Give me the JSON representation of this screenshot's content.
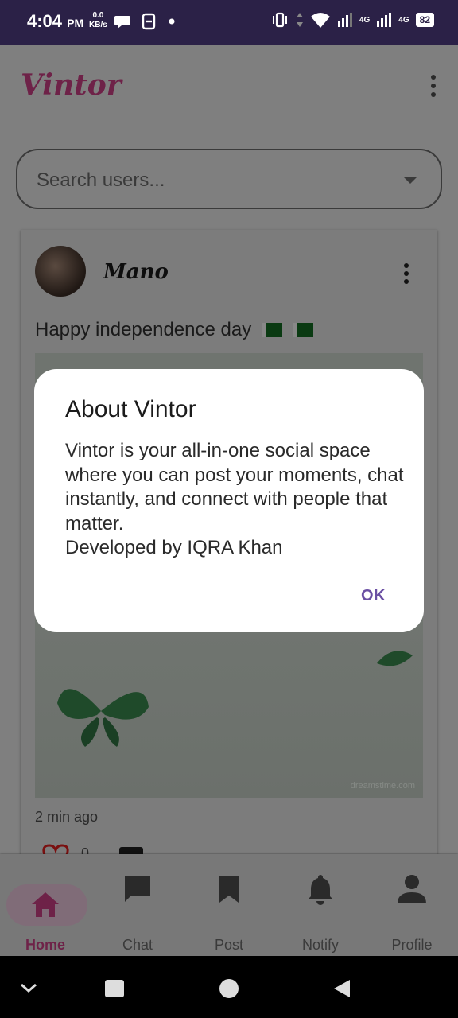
{
  "status_bar": {
    "time": "4:04",
    "ampm": "PM",
    "speed_value": "0.0",
    "speed_unit": "KB/s",
    "network_label_1": "4G",
    "network_label_2": "4G",
    "battery": "82"
  },
  "app": {
    "title": "Vintor",
    "search_placeholder": "Search users..."
  },
  "post": {
    "author": "Mano",
    "text": "Happy independence day",
    "watermark": "dreamstime.com",
    "time_ago": "2 min ago",
    "like_count": "0"
  },
  "dialog": {
    "title": "About Vintor",
    "body": "Vintor is your all-in-one social space where you can post your moments, chat instantly, and connect with people that matter.\nDeveloped by IQRA Khan",
    "ok_label": "OK"
  },
  "bottom_nav": {
    "items": [
      {
        "label": "Home",
        "icon": "home-icon",
        "active": true
      },
      {
        "label": "Chat",
        "icon": "chat-icon",
        "active": false
      },
      {
        "label": "Post",
        "icon": "bookmark-icon",
        "active": false
      },
      {
        "label": "Notify",
        "icon": "bell-icon",
        "active": false
      },
      {
        "label": "Profile",
        "icon": "person-icon",
        "active": false
      }
    ]
  },
  "colors": {
    "brand": "#6e2248",
    "status_bar": "#2b2147",
    "dialog_action": "#6a4fa3"
  }
}
